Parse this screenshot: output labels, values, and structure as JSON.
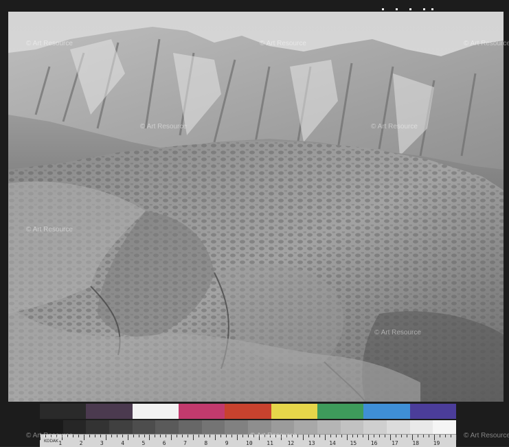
{
  "image": {
    "subject": "black-and-white-badlands-landscape",
    "colors": {
      "sky": "#dcdcdc",
      "border": "#1c1c1c"
    }
  },
  "watermark": {
    "text": "© Art Resource"
  },
  "color_target": {
    "swatches": [
      "#2a2a2a",
      "#4b3a4f",
      "#f2f2f2",
      "#c23a6d",
      "#c8422e",
      "#e6d64a",
      "#3e9b5b",
      "#3f8fd6",
      "#4b3d9a"
    ],
    "gray_steps": [
      "#1a1a1a",
      "#262626",
      "#333333",
      "#404040",
      "#4d4d4d",
      "#5a5a5a",
      "#676767",
      "#747474",
      "#818181",
      "#8e8e8e",
      "#9b9b9b",
      "#a8a8a8",
      "#b5b5b5",
      "#c2c2c2",
      "#cfcfcf",
      "#dcdcdc",
      "#e9e9e9",
      "#f5f5f5"
    ],
    "ruler_numbers": [
      "1",
      "2",
      "3",
      "4",
      "5",
      "6",
      "7",
      "8",
      "9",
      "10",
      "11",
      "12",
      "13",
      "14",
      "15",
      "16",
      "17",
      "18",
      "19"
    ],
    "ruler_label": "KODAK"
  }
}
